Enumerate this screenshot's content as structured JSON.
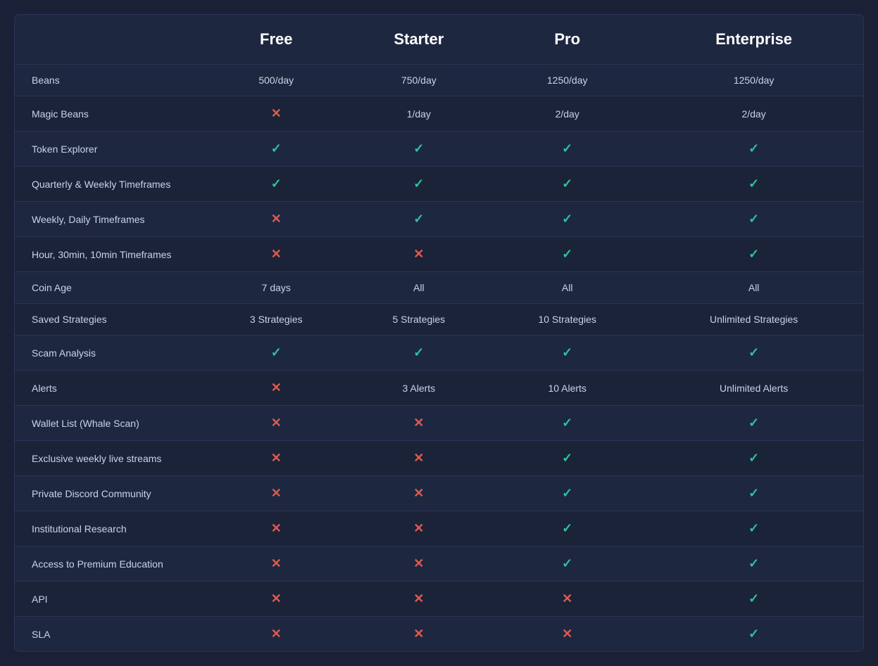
{
  "table": {
    "columns": [
      {
        "id": "feature",
        "label": ""
      },
      {
        "id": "free",
        "label": "Free"
      },
      {
        "id": "starter",
        "label": "Starter"
      },
      {
        "id": "pro",
        "label": "Pro"
      },
      {
        "id": "enterprise",
        "label": "Enterprise"
      }
    ],
    "rows": [
      {
        "feature": "Beans",
        "free": {
          "type": "text",
          "value": "500/day"
        },
        "starter": {
          "type": "text",
          "value": "750/day"
        },
        "pro": {
          "type": "text",
          "value": "1250/day"
        },
        "enterprise": {
          "type": "text",
          "value": "1250/day"
        }
      },
      {
        "feature": "Magic Beans",
        "free": {
          "type": "cross"
        },
        "starter": {
          "type": "text",
          "value": "1/day"
        },
        "pro": {
          "type": "text",
          "value": "2/day"
        },
        "enterprise": {
          "type": "text",
          "value": "2/day"
        }
      },
      {
        "feature": "Token Explorer",
        "free": {
          "type": "check"
        },
        "starter": {
          "type": "check"
        },
        "pro": {
          "type": "check"
        },
        "enterprise": {
          "type": "check"
        }
      },
      {
        "feature": "Quarterly & Weekly Timeframes",
        "free": {
          "type": "check"
        },
        "starter": {
          "type": "check"
        },
        "pro": {
          "type": "check"
        },
        "enterprise": {
          "type": "check"
        }
      },
      {
        "feature": "Weekly, Daily Timeframes",
        "free": {
          "type": "cross"
        },
        "starter": {
          "type": "check"
        },
        "pro": {
          "type": "check"
        },
        "enterprise": {
          "type": "check"
        }
      },
      {
        "feature": "Hour, 30min, 10min Timeframes",
        "free": {
          "type": "cross"
        },
        "starter": {
          "type": "cross"
        },
        "pro": {
          "type": "check"
        },
        "enterprise": {
          "type": "check"
        }
      },
      {
        "feature": "Coin Age",
        "free": {
          "type": "text",
          "value": "7 days"
        },
        "starter": {
          "type": "text",
          "value": "All"
        },
        "pro": {
          "type": "text",
          "value": "All"
        },
        "enterprise": {
          "type": "text",
          "value": "All"
        }
      },
      {
        "feature": "Saved Strategies",
        "free": {
          "type": "text",
          "value": "3 Strategies"
        },
        "starter": {
          "type": "text",
          "value": "5 Strategies"
        },
        "pro": {
          "type": "text",
          "value": "10 Strategies"
        },
        "enterprise": {
          "type": "text",
          "value": "Unlimited Strategies"
        }
      },
      {
        "feature": "Scam Analysis",
        "free": {
          "type": "check"
        },
        "starter": {
          "type": "check"
        },
        "pro": {
          "type": "check"
        },
        "enterprise": {
          "type": "check"
        }
      },
      {
        "feature": "Alerts",
        "free": {
          "type": "cross"
        },
        "starter": {
          "type": "text",
          "value": "3 Alerts"
        },
        "pro": {
          "type": "text",
          "value": "10 Alerts"
        },
        "enterprise": {
          "type": "text",
          "value": "Unlimited Alerts"
        }
      },
      {
        "feature": "Wallet List (Whale Scan)",
        "free": {
          "type": "cross"
        },
        "starter": {
          "type": "cross"
        },
        "pro": {
          "type": "check"
        },
        "enterprise": {
          "type": "check"
        }
      },
      {
        "feature": "Exclusive weekly live streams",
        "free": {
          "type": "cross"
        },
        "starter": {
          "type": "cross"
        },
        "pro": {
          "type": "check"
        },
        "enterprise": {
          "type": "check"
        }
      },
      {
        "feature": "Private Discord Community",
        "free": {
          "type": "cross"
        },
        "starter": {
          "type": "cross"
        },
        "pro": {
          "type": "check"
        },
        "enterprise": {
          "type": "check"
        }
      },
      {
        "feature": "Institutional Research",
        "free": {
          "type": "cross"
        },
        "starter": {
          "type": "cross"
        },
        "pro": {
          "type": "check"
        },
        "enterprise": {
          "type": "check"
        }
      },
      {
        "feature": "Access to Premium Education",
        "free": {
          "type": "cross"
        },
        "starter": {
          "type": "cross"
        },
        "pro": {
          "type": "check"
        },
        "enterprise": {
          "type": "check"
        }
      },
      {
        "feature": "API",
        "free": {
          "type": "cross"
        },
        "starter": {
          "type": "cross"
        },
        "pro": {
          "type": "cross"
        },
        "enterprise": {
          "type": "check"
        }
      },
      {
        "feature": "SLA",
        "free": {
          "type": "cross"
        },
        "starter": {
          "type": "cross"
        },
        "pro": {
          "type": "cross"
        },
        "enterprise": {
          "type": "check"
        }
      }
    ],
    "check_symbol": "✓",
    "cross_symbol": "✕"
  }
}
